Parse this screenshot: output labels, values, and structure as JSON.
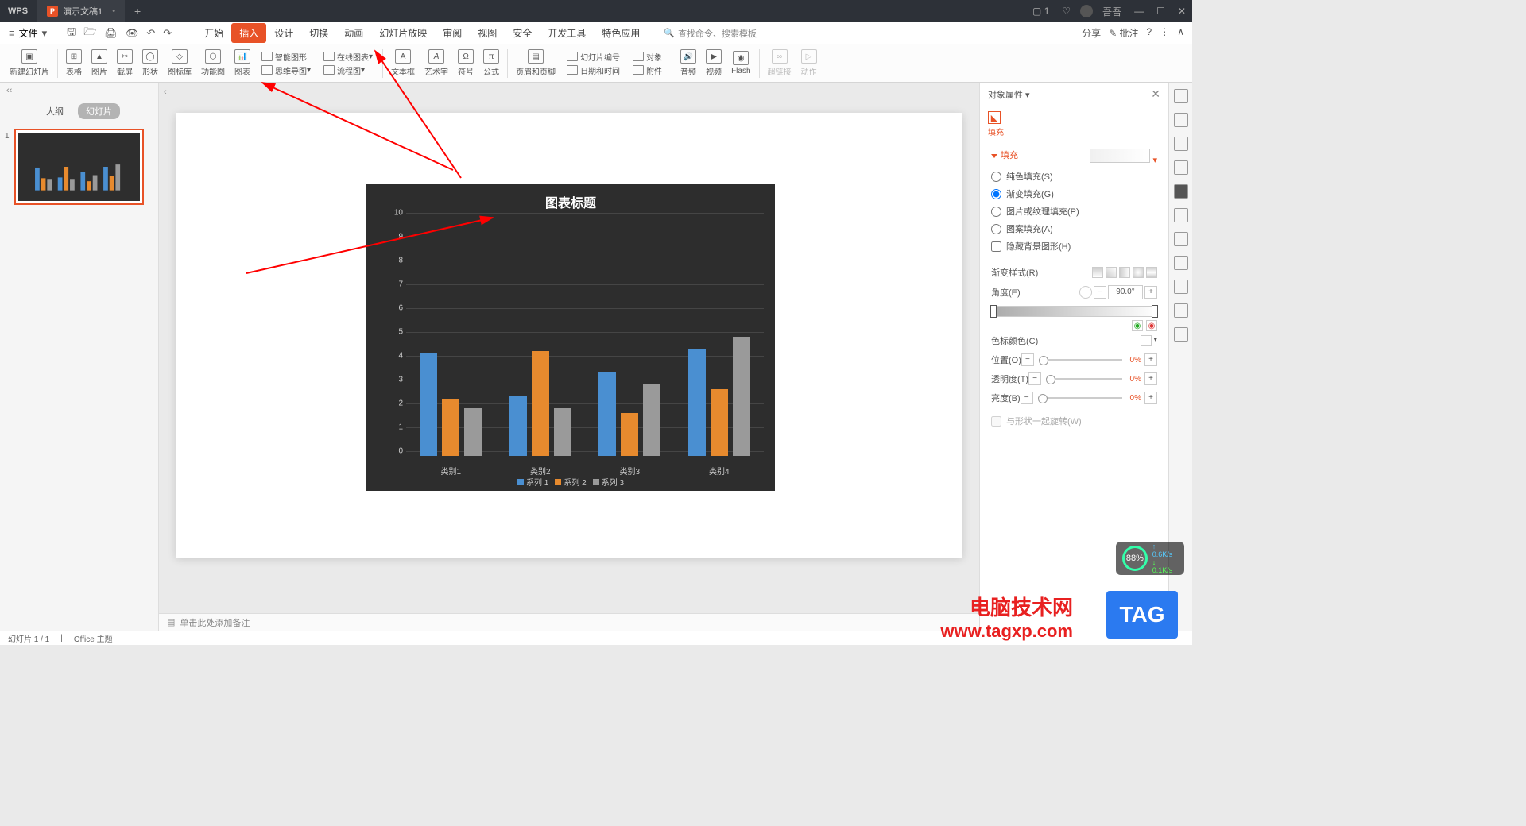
{
  "titlebar": {
    "logo": "WPS",
    "tab_title": "演示文稿1",
    "tab_icon": "P",
    "user": "吾吾"
  },
  "menubar": {
    "file": "文件",
    "tabs": [
      "开始",
      "插入",
      "设计",
      "切换",
      "动画",
      "幻灯片放映",
      "审阅",
      "视图",
      "安全",
      "开发工具",
      "特色应用"
    ],
    "active_index": 1,
    "search_placeholder": "查找命令、搜索模板",
    "share": "分享",
    "review": "批注"
  },
  "ribbon": {
    "new_slide": "新建幻灯片",
    "table": "表格",
    "picture": "图片",
    "screenshot": "截屏",
    "shape": "形状",
    "iconlib": "图标库",
    "function": "功能图",
    "chart": "图表",
    "smart_graphic": "智能图形",
    "online_chart": "在线图表",
    "flowchart": "流程图",
    "mindmap": "思维导图",
    "textbox": "文本框",
    "wordart": "艺术字",
    "symbol": "符号",
    "formula": "公式",
    "header_footer": "页眉和页脚",
    "slide_number": "幻灯片编号",
    "datetime": "日期和时间",
    "object": "对象",
    "attachment": "附件",
    "audio": "音频",
    "video": "视频",
    "flash": "Flash",
    "hyperlink": "超链接",
    "action": "动作"
  },
  "slides_panel": {
    "outline": "大纲",
    "slides": "幻灯片"
  },
  "notes_placeholder": "单击此处添加备注",
  "chart_data": {
    "type": "bar",
    "title": "图表标题",
    "categories": [
      "类别1",
      "类别2",
      "类别3",
      "类别4"
    ],
    "series": [
      {
        "name": "系列 1",
        "color": "#4a8fd1",
        "values": [
          4.3,
          2.5,
          3.5,
          4.5
        ]
      },
      {
        "name": "系列 2",
        "color": "#e78a2e",
        "values": [
          2.4,
          4.4,
          1.8,
          2.8
        ]
      },
      {
        "name": "系列 3",
        "color": "#9a9a9a",
        "values": [
          2.0,
          2.0,
          3.0,
          5.0
        ]
      }
    ],
    "ylim": [
      0,
      10
    ],
    "yticks": [
      0,
      1,
      2,
      3,
      4,
      5,
      6,
      7,
      8,
      9,
      10
    ]
  },
  "properties": {
    "panel_title": "对象属性",
    "fill_tab": "填充",
    "section_fill": "填充",
    "solid_fill": "纯色填充(S)",
    "gradient_fill": "渐变填充(G)",
    "picture_fill": "图片或纹理填充(P)",
    "pattern_fill": "图案填充(A)",
    "hide_bg": "隐藏背景图形(H)",
    "gradient_style": "渐变样式(R)",
    "angle": "角度(E)",
    "angle_value": "90.0°",
    "color_label": "色标颜色(C)",
    "position": "位置(O)",
    "transparency": "透明度(T)",
    "brightness": "亮度(B)",
    "zero_pct": "0%",
    "rotate_with_shape": "与形状一起旋转(W)"
  },
  "status": {
    "slide": "幻灯片 1 / 1",
    "theme": "Office 主题"
  },
  "widgets": {
    "watermark1": "电脑技术网",
    "watermark2": "www.tagxp.com",
    "tag": "TAG",
    "net_pct": "88%",
    "net_up": "0.6K/s",
    "net_dn": "0.1K/s"
  }
}
